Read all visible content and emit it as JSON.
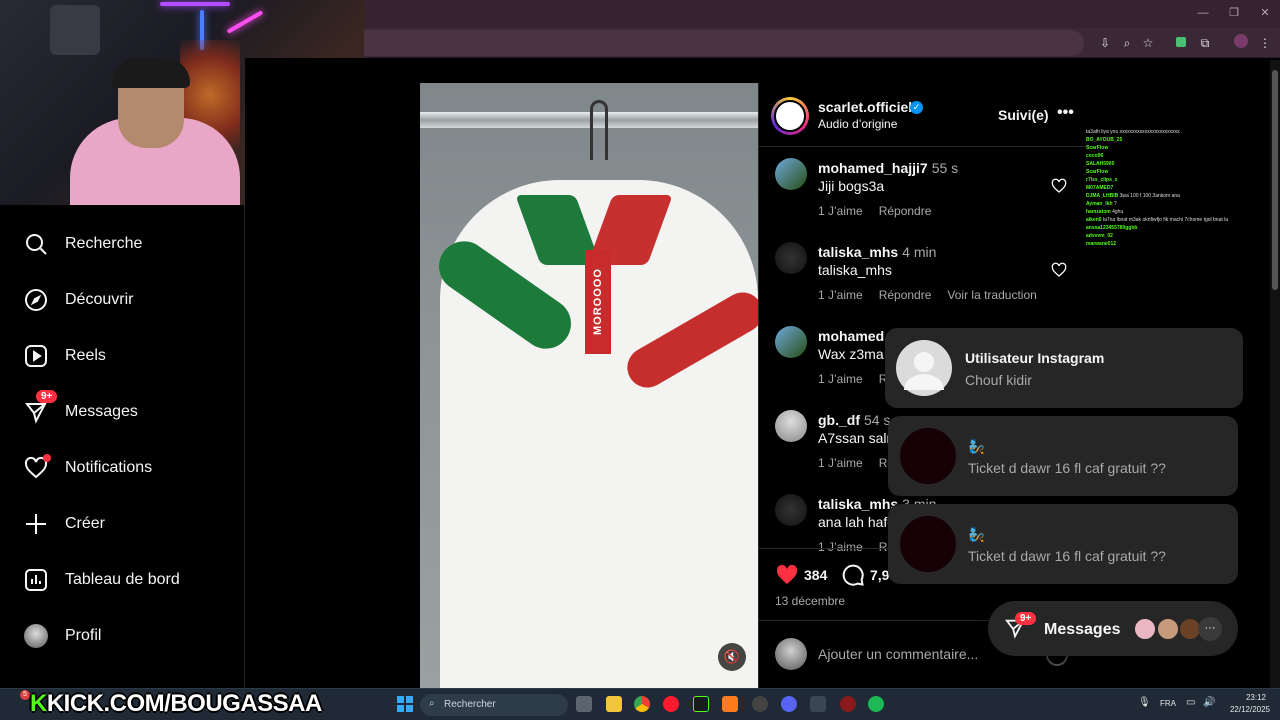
{
  "browser": {
    "window_buttons": [
      "—",
      "❐",
      "✕"
    ],
    "toolbar_icons": [
      "install-icon",
      "zoom-icon",
      "star-icon",
      "extension-icon",
      "puzzle-icon",
      "profile-icon",
      "menu-icon"
    ]
  },
  "sidebar": {
    "items": [
      {
        "label": "Recherche",
        "icon": "search-icon"
      },
      {
        "label": "Découvrir",
        "icon": "compass-icon"
      },
      {
        "label": "Reels",
        "icon": "reels-icon"
      },
      {
        "label": "Messages",
        "icon": "messenger-icon",
        "badge": "9+"
      },
      {
        "label": "Notifications",
        "icon": "heart-icon"
      },
      {
        "label": "Créer",
        "icon": "plus-icon"
      },
      {
        "label": "Tableau de bord",
        "icon": "dashboard-icon"
      },
      {
        "label": "Profil",
        "icon": "avatar"
      }
    ]
  },
  "post": {
    "author": "scarlet.officiel",
    "audio": "Audio d’origine",
    "follow_label": "Suivi(e)",
    "more": "•••",
    "image_text": "MOROOOO",
    "likes": "384",
    "comments_count": "7,9",
    "date": "13 décembre",
    "comment_placeholder": "Ajouter un commentaire..."
  },
  "comments": [
    {
      "user": "mohamed_hajji7",
      "time": "55 s",
      "text": "Jiji bogs3a",
      "likes": "1 J’aime",
      "reply": "Répondre",
      "translate": ""
    },
    {
      "user": "taliska_mhs",
      "time": "4 min",
      "text": "taliska_mhs",
      "likes": "1 J’aime",
      "reply": "Répondre",
      "translate": "Voir la traduction"
    },
    {
      "user": "mohamed",
      "time": "",
      "text": "Wax z3ma",
      "likes": "1 J’aime",
      "reply": "Ré",
      "translate": ""
    },
    {
      "user": "gb._df",
      "time": "54 s",
      "text": "A7ssan saln",
      "likes": "1 J’aime",
      "reply": "Rép",
      "translate": ""
    },
    {
      "user": "taliska_mhs",
      "time": "3 min",
      "text": "ana lah hafe",
      "likes": "1 J’aime",
      "reply": "Rép",
      "translate": ""
    }
  ],
  "toasts": [
    {
      "title": "Utilisateur Instagram",
      "subtitle": "Chouf kidir"
    },
    {
      "title": "🧞",
      "subtitle": "Ticket d dawr 16 fl caf gratuit ??"
    },
    {
      "title": "🧞",
      "subtitle": "Ticket d dawr 16 fl caf gratuit ??"
    }
  ],
  "messages_pill": {
    "label": "Messages",
    "badge": "9+",
    "more": "···"
  },
  "stream": {
    "kick_k": "K",
    "kick_text": "KICK.COM/BOUGASSAA",
    "chat": [
      {
        "user": "",
        "text": "ta3ath liya you xxxxxxxxxxxxxxxxxxxxxxxx"
      },
      {
        "user": "BO_AYOUB_25",
        "text": ""
      },
      {
        "user": "ScarFlow",
        "text": ""
      },
      {
        "user": "coco96",
        "text": ""
      },
      {
        "user": "SALAH5900",
        "text": ""
      },
      {
        "user": "ScarFlow",
        "text": ""
      },
      {
        "user": "r7lss_clips_x",
        "text": ""
      },
      {
        "user": "M07AMED7",
        "text": ""
      },
      {
        "user": "DJMA_LHBIB",
        "text": "3wa 100 f 100 3ankom ana"
      },
      {
        "user": "Ayman_lkh",
        "text": "?"
      },
      {
        "user": "hamzatom",
        "text": "4ghu"
      },
      {
        "user": "alken0",
        "text": "la7na lbnat m3ak oknfiwfjo fik machi 7chome tgol bnat la"
      },
      {
        "user": "anssa123455789ggbb",
        "text": ""
      },
      {
        "user": "advvvm_02",
        "text": ""
      },
      {
        "user": "marwane012",
        "text": ""
      }
    ]
  },
  "taskbar": {
    "search_placeholder": "Rechercher",
    "lang": "FRA",
    "time": "23:12",
    "date": "22/12/2025",
    "notif_badge": "5"
  },
  "colors": {
    "accent_blue": "#0095f6",
    "like_red": "#ff3040",
    "kick_green": "#53fc18"
  }
}
